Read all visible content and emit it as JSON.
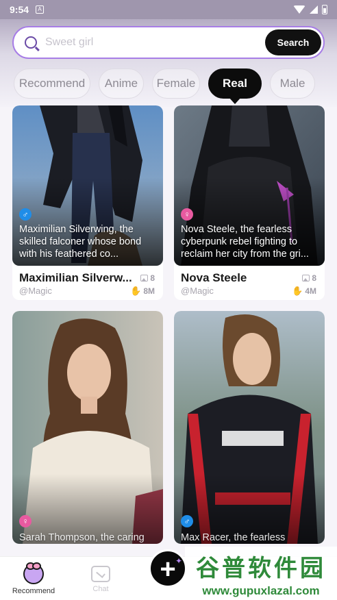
{
  "status_bar": {
    "time": "9:54",
    "notif": "A"
  },
  "search": {
    "placeholder": "Sweet girl",
    "button_label": "Search"
  },
  "tabs": [
    {
      "label": "Recommend"
    },
    {
      "label": "Anime"
    },
    {
      "label": "Female"
    },
    {
      "label": "Real",
      "active": true
    },
    {
      "label": "Male"
    }
  ],
  "cards": [
    {
      "gender": "male",
      "gender_symbol": "♂",
      "description": "Maximilian Silverwing, the skilled falconer whose bond with his feathered co...",
      "name": "Maximilian Silverw...",
      "handle": "@Magic",
      "photos": "8",
      "likes": "8M"
    },
    {
      "gender": "female",
      "gender_symbol": "♀",
      "description": "Nova Steele, the fearless cyberpunk rebel fighting to reclaim her city from the gri...",
      "name": "Nova Steele",
      "handle": "@Magic",
      "photos": "8",
      "likes": "4M"
    },
    {
      "gender": "female",
      "gender_symbol": "♀",
      "description": "Sarah Thompson, the caring"
    },
    {
      "gender": "male",
      "gender_symbol": "♂",
      "description": "Max Racer, the fearless"
    }
  ],
  "nav": {
    "recommend_label": "Recommend",
    "chat_label": "Chat",
    "create_symbol": "+"
  },
  "watermark": {
    "line1": "谷普软件园",
    "line2": "www.gupuxlazal.com"
  },
  "colors": {
    "accent": "#a77de6",
    "brand_dark": "#0c0c0c",
    "male": "#1f8de8",
    "female": "#e85aa0"
  }
}
